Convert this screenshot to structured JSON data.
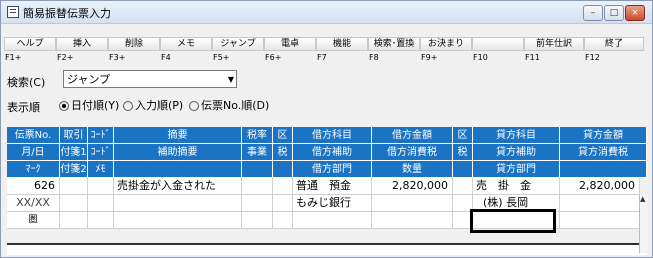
{
  "window": {
    "title": "簡易振替伝票入力"
  },
  "fkeys": [
    {
      "label": "ヘルプ",
      "key": "F1+"
    },
    {
      "label": "挿入",
      "key": "F2+"
    },
    {
      "label": "削除",
      "key": "F3+"
    },
    {
      "label": "メモ",
      "key": "F4"
    },
    {
      "label": "ジャンプ",
      "key": "F5+"
    },
    {
      "label": "電卓",
      "key": "F6+"
    },
    {
      "label": "機能",
      "key": "F7"
    },
    {
      "label": "検索･置換",
      "key": "F8"
    },
    {
      "label": "お決まり",
      "key": "F9+"
    },
    {
      "label": "",
      "key": "F10"
    },
    {
      "label": "前年仕訳",
      "key": "F11"
    },
    {
      "label": "終了",
      "key": "F12"
    }
  ],
  "search": {
    "label": "検索(C)",
    "value": "ジャンプ"
  },
  "order": {
    "label": "表示順",
    "options": [
      {
        "label": "日付順(Y)",
        "selected": true
      },
      {
        "label": "入力順(P)",
        "selected": false
      },
      {
        "label": "伝票No.順(D)",
        "selected": false
      }
    ]
  },
  "headers": [
    [
      "伝票No.",
      "取引",
      "ｺｰﾄﾞ",
      "摘要",
      "税率",
      "区",
      "借方科目",
      "借方金額",
      "区",
      "貸方科目",
      "貸方金額"
    ],
    [
      "月/日",
      "付箋1",
      "ｺｰﾄﾞ",
      "補助摘要",
      "事業",
      "税",
      "借方補助",
      "借方消費税",
      "税",
      "貸方補助",
      "貸方消費税"
    ],
    [
      "ﾏｰｸ",
      "付箋2",
      "ﾒﾓ",
      "",
      "",
      "",
      "借方部門",
      "数量",
      "",
      "貸方部門",
      ""
    ]
  ],
  "rows": {
    "r1": {
      "no": "626",
      "summary": "売掛金が入金された",
      "debit_acct": "普通　預金",
      "debit_amt": "2,820,000",
      "credit_acct": "売　掛　金",
      "credit_amt": "2,820,000"
    },
    "r2": {
      "date": "XX/XX",
      "debit_sub": "もみじ銀行",
      "credit_sub": "(株) 長岡"
    },
    "r3": {
      "mark": "圏"
    }
  }
}
